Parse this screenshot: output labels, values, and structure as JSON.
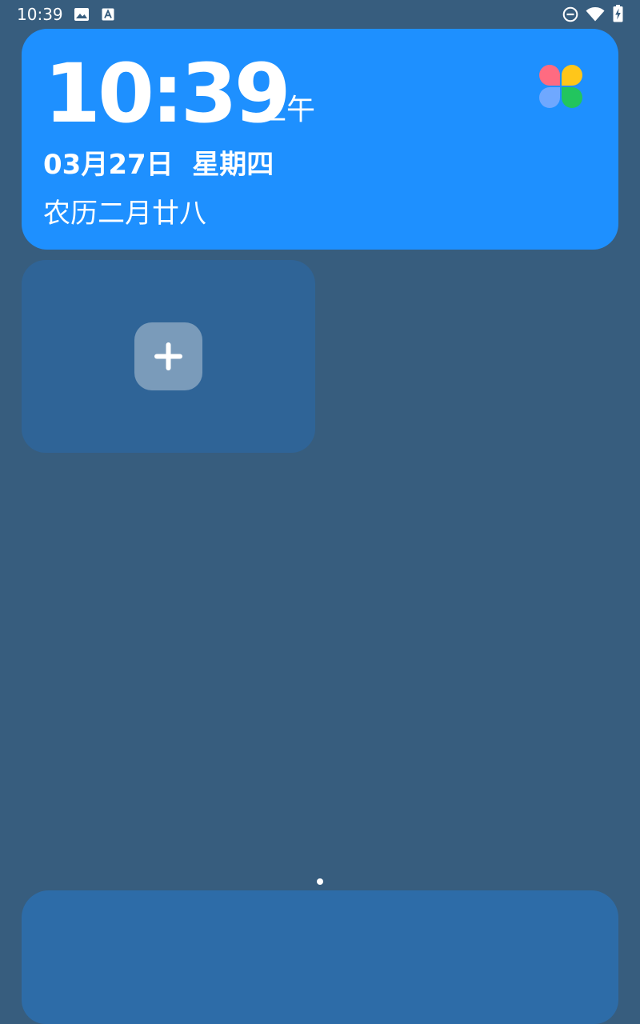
{
  "status_bar": {
    "time": "10:39",
    "left_icons": [
      "image-icon",
      "font-a-icon"
    ],
    "right_icons": [
      "do-not-disturb-icon",
      "wifi-icon",
      "battery-charging-icon"
    ]
  },
  "clock_widget": {
    "time": "10:39",
    "am_pm": "上午",
    "date": "03月27日  星期四",
    "lunar_date": "农历二月廿八",
    "background_color": "#1E90FF",
    "app_icon": "clover-icon",
    "app_icon_colors": [
      "#FF6B81",
      "#FFC61A",
      "#6FA8FF",
      "#22C55E"
    ]
  },
  "add_widget": {
    "button_icon": "plus-icon"
  },
  "page_indicator": {
    "pages": 1,
    "current": 1
  },
  "colors": {
    "wallpaper": "#375D7E",
    "add_widget_card": "#2F6497",
    "dock": "#2D6CA8"
  }
}
